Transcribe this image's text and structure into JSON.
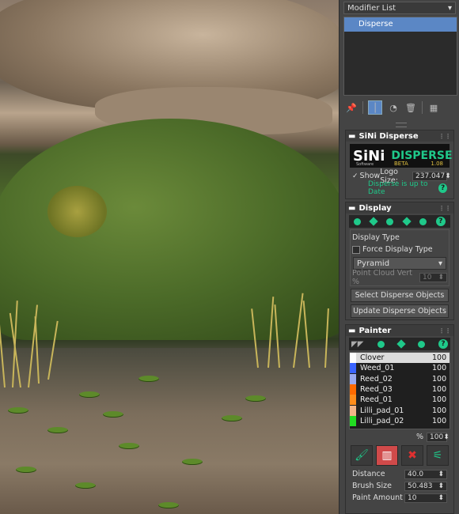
{
  "viewport": {
    "scene": "3D render viewport"
  },
  "modifier": {
    "list_label": "Modifier List",
    "stack_item": "Disperse"
  },
  "toolbar": {
    "icons": [
      "pin-icon",
      "show-end-result-icon",
      "make-unique-icon",
      "remove-modifier-icon",
      "configure-sets-icon"
    ]
  },
  "sini": {
    "title": "SiNi Disperse",
    "logo_left": "SiNi",
    "logo_sub": "Software",
    "logo_right": "DISPERSE",
    "beta": "BETA",
    "version": "1.08",
    "show_label": "Show",
    "logo_size_label": "Logo Size:",
    "logo_size_value": "237.047",
    "status": "Disperse is up to Date"
  },
  "display": {
    "title": "Display",
    "type_label": "Display Type",
    "force_label": "Force Display Type",
    "mode": "Pyramid",
    "point_cloud_label": "Point Cloud Vert %",
    "point_cloud_value": "10",
    "select_btn": "Select Disperse Objects",
    "update_btn": "Update Disperse Objects"
  },
  "painter": {
    "title": "Painter",
    "items": [
      {
        "name": "Clover",
        "value": "100",
        "color": "#ffffff"
      },
      {
        "name": "Weed_01",
        "value": "100",
        "color": "#3a64ff"
      },
      {
        "name": "Reed_02",
        "value": "100",
        "color": "#9aaaf0"
      },
      {
        "name": "Reed_03",
        "value": "100",
        "color": "#ff6a00"
      },
      {
        "name": "Reed_01",
        "value": "100",
        "color": "#ff8c1a"
      },
      {
        "name": "Lilli_pad_01",
        "value": "100",
        "color": "#f2b488"
      },
      {
        "name": "Lilli_pad_02",
        "value": "100",
        "color": "#22dd22"
      }
    ],
    "percent_label": "%",
    "percent_value": "100",
    "distance_label": "Distance",
    "distance_value": "40.0",
    "brush_label": "Brush Size",
    "brush_value": "50.483",
    "amount_label": "Paint Amount",
    "amount_value": "10"
  },
  "colors": {
    "accent": "#1fc98a",
    "selection": "#5b87c5"
  }
}
